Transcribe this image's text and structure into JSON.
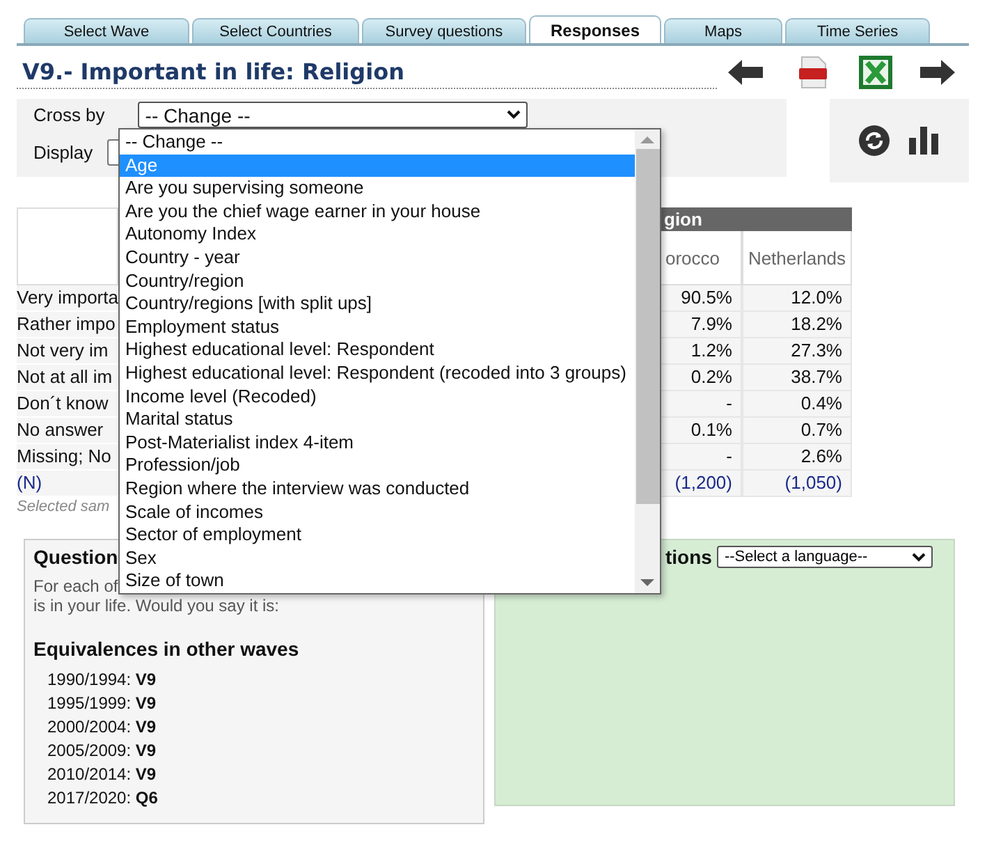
{
  "tabs": [
    {
      "label": "Select Wave",
      "selected": false
    },
    {
      "label": "Select Countries",
      "selected": false
    },
    {
      "label": "Survey questions",
      "selected": false
    },
    {
      "label": "Responses",
      "selected": true
    },
    {
      "label": "Maps",
      "selected": false
    },
    {
      "label": "Time Series",
      "selected": false
    }
  ],
  "title": "V9.- Important in life: Religion",
  "controls": {
    "cross_by_label": "Cross by",
    "cross_by_value": "-- Change --",
    "display_label": "Display"
  },
  "dropdown": {
    "items": [
      {
        "label": "-- Change --",
        "selected": false
      },
      {
        "label": "Age",
        "selected": true
      },
      {
        "label": "Are you supervising someone",
        "selected": false
      },
      {
        "label": "Are you the chief wage earner in your house",
        "selected": false
      },
      {
        "label": "Autonomy Index",
        "selected": false
      },
      {
        "label": "Country - year",
        "selected": false
      },
      {
        "label": "Country/region",
        "selected": false
      },
      {
        "label": "Country/regions [with split ups]",
        "selected": false
      },
      {
        "label": "Employment status",
        "selected": false
      },
      {
        "label": "Highest educational level: Respondent",
        "selected": false
      },
      {
        "label": "Highest educational level: Respondent (recoded into 3 groups)",
        "selected": false
      },
      {
        "label": "Income level (Recoded)",
        "selected": false
      },
      {
        "label": "Marital status",
        "selected": false
      },
      {
        "label": "Post-Materialist index 4-item",
        "selected": false
      },
      {
        "label": "Profession/job",
        "selected": false
      },
      {
        "label": "Region where the interview was conducted",
        "selected": false
      },
      {
        "label": "Scale of incomes",
        "selected": false
      },
      {
        "label": "Sector of employment",
        "selected": false
      },
      {
        "label": "Sex",
        "selected": false
      },
      {
        "label": "Size of town",
        "selected": false
      }
    ]
  },
  "table": {
    "group_header": "gion",
    "columns": [
      "orocco",
      "Netherlands"
    ],
    "rows": [
      {
        "label": "Very importa",
        "values": [
          "90.5%",
          "12.0%"
        ],
        "kind": "value"
      },
      {
        "label": "Rather impo",
        "values": [
          "7.9%",
          "18.2%"
        ],
        "kind": "value"
      },
      {
        "label": "Not very im",
        "values": [
          "1.2%",
          "27.3%"
        ],
        "kind": "value"
      },
      {
        "label": "Not at all im",
        "values": [
          "0.2%",
          "38.7%"
        ],
        "kind": "value"
      },
      {
        "label": "Don´t know",
        "values": [
          "-",
          "0.4%"
        ],
        "kind": "value"
      },
      {
        "label": "No answer",
        "values": [
          "0.1%",
          "0.7%"
        ],
        "kind": "value"
      },
      {
        "label": "Missing; No",
        "values": [
          "-",
          "2.6%"
        ],
        "kind": "value"
      },
      {
        "label": "(N)",
        "values": [
          "(1,200)",
          "(1,050)"
        ],
        "kind": "count"
      }
    ],
    "note": "Selected sam"
  },
  "question_panel": {
    "heading": "Question",
    "text_lines": [
      "For each of",
      "is in your life. Would you say it is:"
    ],
    "equivalences_heading": "Equivalences in other waves",
    "equivalences": [
      {
        "wave": "1990/1994:",
        "code": "V9"
      },
      {
        "wave": "1995/1999:",
        "code": "V9"
      },
      {
        "wave": "2000/2004:",
        "code": "V9"
      },
      {
        "wave": "2005/2009:",
        "code": "V9"
      },
      {
        "wave": "2010/2014:",
        "code": "V9"
      },
      {
        "wave": "2017/2020:",
        "code": "Q6"
      }
    ]
  },
  "translations_panel": {
    "heading": "tions",
    "language_select": "--Select a language--"
  }
}
